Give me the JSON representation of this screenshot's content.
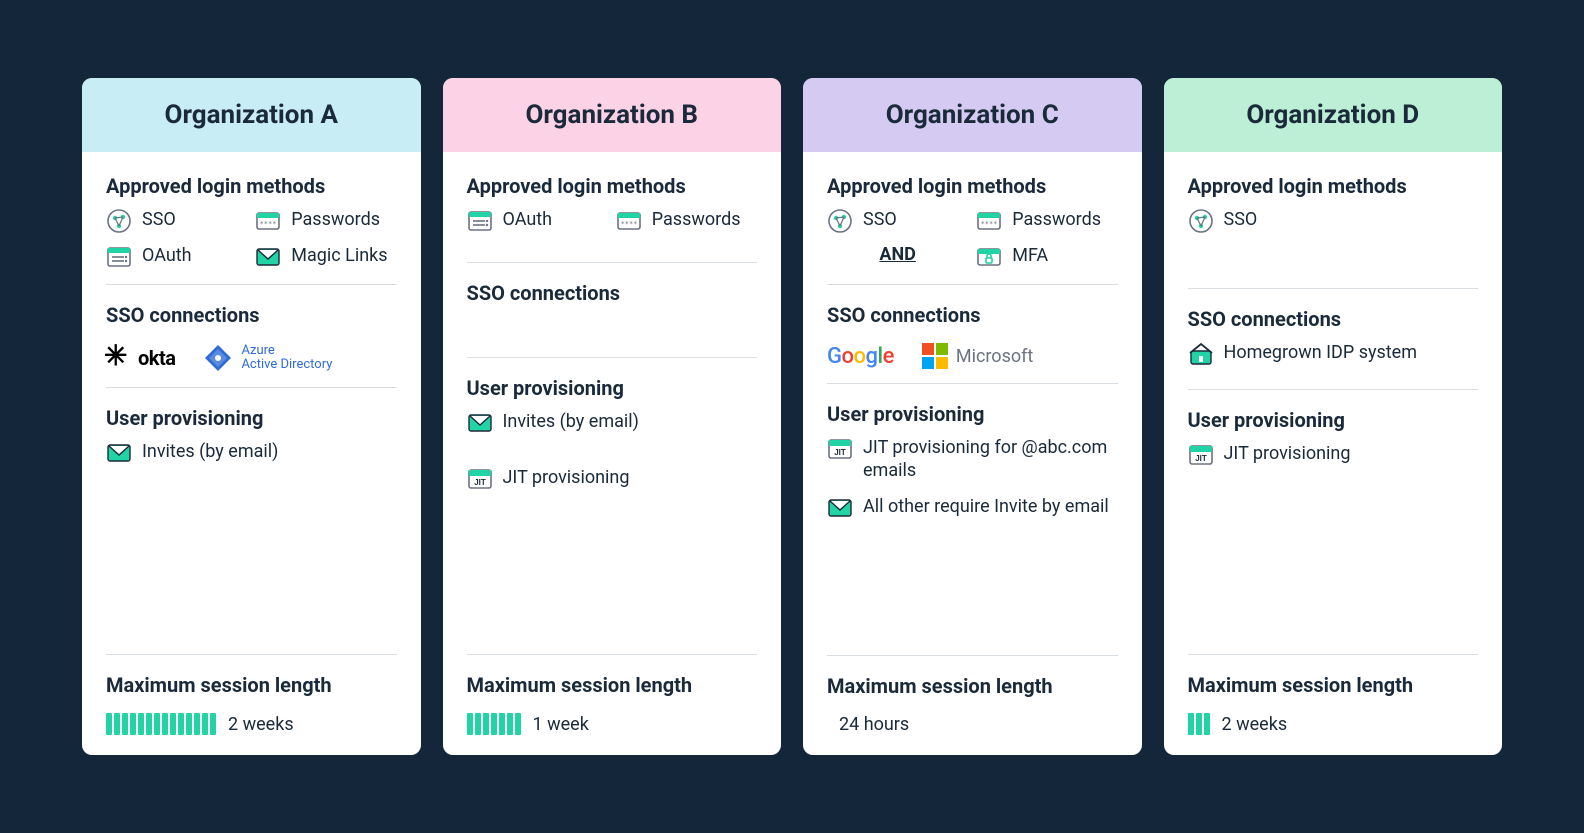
{
  "labels": {
    "approved": "Approved login methods",
    "sso_connections": "SSO connections",
    "user_provisioning": "User provisioning",
    "max_session": "Maximum session length",
    "and": "AND"
  },
  "methods": {
    "sso": "SSO",
    "passwords": "Passwords",
    "oauth": "OAuth",
    "magic_links": "Magic Links",
    "mfa": "MFA"
  },
  "provisioning": {
    "invites_email": "Invites (by email)",
    "jit": "JIT provisioning",
    "jit_abc": "JIT provisioning for @abc.com emails",
    "other_invite": "All other require Invite by email"
  },
  "connections": {
    "okta": "okta",
    "azure_line1": "Azure",
    "azure_line2": "Active Directory",
    "google": "Google",
    "microsoft": "Microsoft",
    "homegrown": "Homegrown IDP system"
  },
  "orgs": {
    "a": {
      "title": "Organization A",
      "session": "2 weeks",
      "bars": 14
    },
    "b": {
      "title": "Organization B",
      "session": "1 week",
      "bars": 7
    },
    "c": {
      "title": "Organization C",
      "session": "24 hours",
      "bars": 0
    },
    "d": {
      "title": "Organization D",
      "session": "2 weeks",
      "bars": 3
    }
  }
}
